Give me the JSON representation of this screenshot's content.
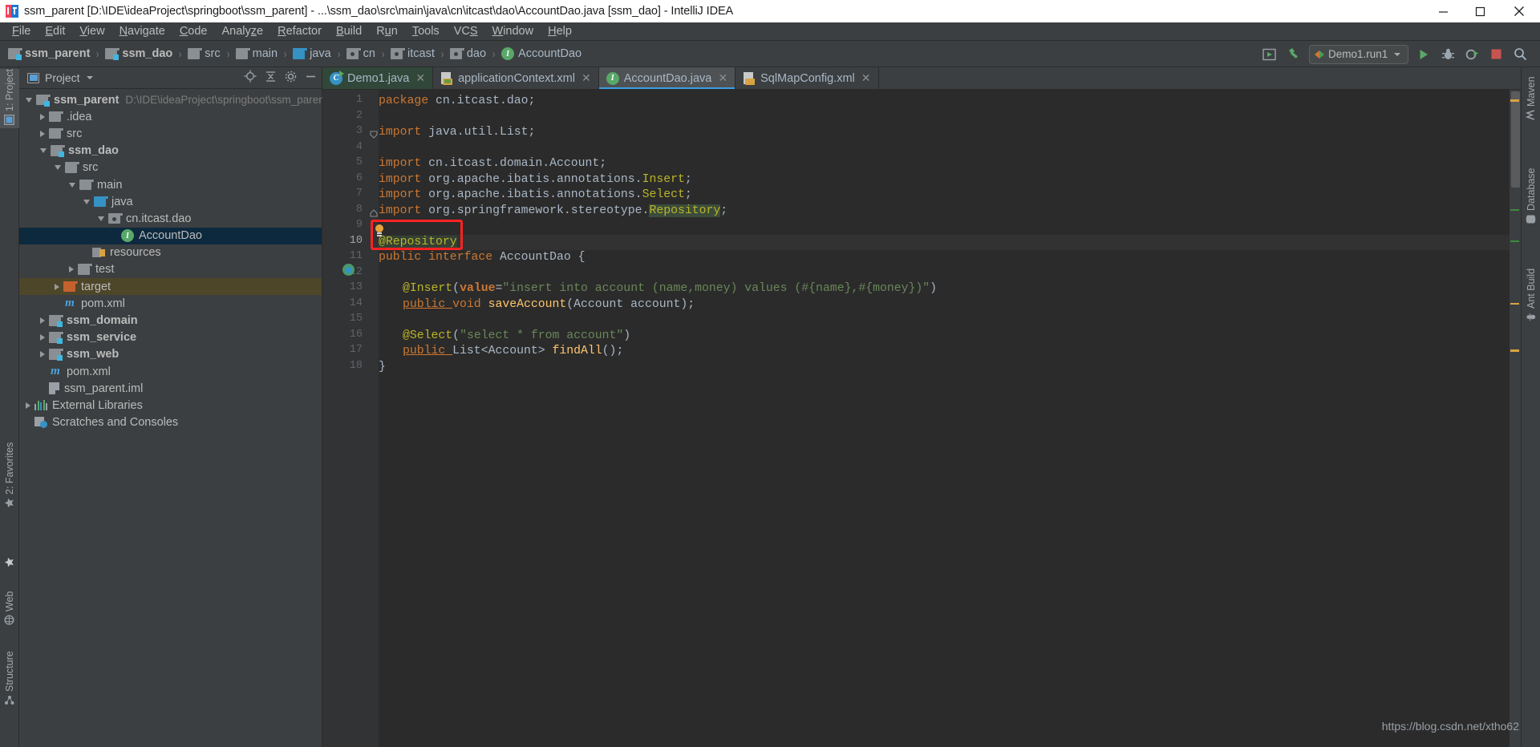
{
  "window": {
    "title": "ssm_parent [D:\\IDE\\ideaProject\\springboot\\ssm_parent] - ...\\ssm_dao\\src\\main\\java\\cn\\itcast\\dao\\AccountDao.java [ssm_dao] - IntelliJ IDEA",
    "icon": "intellij-idea-logo",
    "minimize_label": "Minimize",
    "maximize_label": "Maximize",
    "close_label": "Close"
  },
  "menu": {
    "items": [
      {
        "label": "File",
        "mnemonic": "F"
      },
      {
        "label": "Edit",
        "mnemonic": "E"
      },
      {
        "label": "View",
        "mnemonic": "V"
      },
      {
        "label": "Navigate",
        "mnemonic": "N"
      },
      {
        "label": "Code",
        "mnemonic": "C"
      },
      {
        "label": "Analyze",
        "mnemonic": "z"
      },
      {
        "label": "Refactor",
        "mnemonic": "R"
      },
      {
        "label": "Build",
        "mnemonic": "B"
      },
      {
        "label": "Run",
        "mnemonic": "u"
      },
      {
        "label": "Tools",
        "mnemonic": "T"
      },
      {
        "label": "VCS",
        "mnemonic": "S"
      },
      {
        "label": "Window",
        "mnemonic": "W"
      },
      {
        "label": "Help",
        "mnemonic": "H"
      }
    ]
  },
  "breadcrumb": {
    "separator": "›",
    "items": [
      {
        "label": "ssm_parent",
        "icon": "module-folder-icon",
        "bold": true
      },
      {
        "label": "ssm_dao",
        "icon": "module-folder-icon",
        "bold": true
      },
      {
        "label": "src",
        "icon": "folder-icon",
        "bold": false
      },
      {
        "label": "main",
        "icon": "folder-icon",
        "bold": false
      },
      {
        "label": "java",
        "icon": "source-folder-icon",
        "bold": false
      },
      {
        "label": "cn",
        "icon": "package-icon",
        "bold": false
      },
      {
        "label": "itcast",
        "icon": "package-icon",
        "bold": false
      },
      {
        "label": "dao",
        "icon": "package-icon",
        "bold": false
      },
      {
        "label": "AccountDao",
        "icon": "interface-icon",
        "bold": false
      }
    ]
  },
  "toolbar": {
    "buttons": [
      {
        "name": "select-run-target-icon",
        "label": "Select Run/Debug Target"
      },
      {
        "name": "build-hammer-icon",
        "label": "Build Project"
      }
    ],
    "run_config": {
      "name": "Demo1.run1",
      "icon": "run-configuration-icon",
      "dropdown": "chevron-down-icon"
    },
    "actions": [
      {
        "name": "run-button",
        "label": "Run",
        "color": "#59a869"
      },
      {
        "name": "debug-button",
        "label": "Debug",
        "color": "#9aa7b0"
      },
      {
        "name": "run-coverage-button",
        "label": "Run with Coverage",
        "color": "#9aa7b0"
      },
      {
        "name": "stop-button",
        "label": "Stop",
        "color": "#c75450"
      },
      {
        "name": "search-everywhere-button",
        "label": "Search Everywhere",
        "color": "#a9b7c6"
      }
    ]
  },
  "left_strip": {
    "items": [
      {
        "label": "1: Project",
        "icon": "project-icon",
        "active": true
      },
      {
        "label": "2: Favorites",
        "icon": "favorites-icon",
        "active": false
      },
      {
        "label": "Web",
        "icon": "web-icon",
        "active": false
      },
      {
        "label": "Structure",
        "icon": "structure-icon",
        "active": false
      }
    ]
  },
  "right_strip": {
    "items": [
      {
        "label": "Maven",
        "icon": "maven-icon"
      },
      {
        "label": "Database",
        "icon": "database-icon"
      },
      {
        "label": "Ant Build",
        "icon": "ant-build-icon"
      }
    ]
  },
  "project_panel": {
    "title": "Project",
    "title_dropdown": "chevron-down-icon",
    "actions": [
      {
        "name": "scroll-from-source-icon",
        "label": "Select Opened File"
      },
      {
        "name": "collapse-all-icon",
        "label": "Collapse All"
      },
      {
        "name": "settings-gear-icon",
        "label": "Settings"
      },
      {
        "name": "hide-panel-icon",
        "label": "Hide"
      }
    ],
    "tree": [
      {
        "label": "ssm_parent",
        "secondary": "D:\\IDE\\ideaProject\\springboot\\ssm_parent",
        "indent": 0,
        "arrow": "open",
        "icon": "module-folder-icon",
        "bold": true,
        "state": "normal"
      },
      {
        "label": ".idea",
        "secondary": "",
        "indent": 1,
        "arrow": "closed",
        "icon": "folder-icon",
        "bold": false,
        "state": "normal"
      },
      {
        "label": "src",
        "secondary": "",
        "indent": 1,
        "arrow": "closed",
        "icon": "folder-icon",
        "bold": false,
        "state": "normal"
      },
      {
        "label": "ssm_dao",
        "secondary": "",
        "indent": 1,
        "arrow": "open",
        "icon": "module-folder-icon",
        "bold": true,
        "state": "normal"
      },
      {
        "label": "src",
        "secondary": "",
        "indent": 2,
        "arrow": "open",
        "icon": "folder-icon",
        "bold": false,
        "state": "normal"
      },
      {
        "label": "main",
        "secondary": "",
        "indent": 3,
        "arrow": "open",
        "icon": "folder-icon",
        "bold": false,
        "state": "normal"
      },
      {
        "label": "java",
        "secondary": "",
        "indent": 4,
        "arrow": "open",
        "icon": "source-folder-icon",
        "bold": false,
        "state": "normal"
      },
      {
        "label": "cn.itcast.dao",
        "secondary": "",
        "indent": 5,
        "arrow": "open",
        "icon": "package-icon",
        "bold": false,
        "state": "normal"
      },
      {
        "label": "AccountDao",
        "secondary": "",
        "indent": 6,
        "arrow": "none",
        "icon": "interface-icon",
        "bold": false,
        "state": "selected"
      },
      {
        "label": "resources",
        "secondary": "",
        "indent": 4,
        "arrow": "none",
        "icon": "resources-folder-icon",
        "bold": false,
        "state": "normal"
      },
      {
        "label": "test",
        "secondary": "",
        "indent": 3,
        "arrow": "closed",
        "icon": "folder-icon",
        "bold": false,
        "state": "normal"
      },
      {
        "label": "target",
        "secondary": "",
        "indent": 2,
        "arrow": "closed",
        "icon": "excluded-folder-icon",
        "bold": false,
        "state": "highlighted"
      },
      {
        "label": "pom.xml",
        "secondary": "",
        "indent": 2,
        "arrow": "none",
        "icon": "maven-pom-icon",
        "bold": false,
        "state": "normal"
      },
      {
        "label": "ssm_domain",
        "secondary": "",
        "indent": 1,
        "arrow": "closed",
        "icon": "module-folder-icon",
        "bold": true,
        "state": "normal"
      },
      {
        "label": "ssm_service",
        "secondary": "",
        "indent": 1,
        "arrow": "closed",
        "icon": "module-folder-icon",
        "bold": true,
        "state": "normal"
      },
      {
        "label": "ssm_web",
        "secondary": "",
        "indent": 1,
        "arrow": "closed",
        "icon": "module-folder-icon",
        "bold": true,
        "state": "normal"
      },
      {
        "label": "pom.xml",
        "secondary": "",
        "indent": 1,
        "arrow": "none",
        "icon": "maven-pom-icon",
        "bold": false,
        "state": "normal"
      },
      {
        "label": "ssm_parent.iml",
        "secondary": "",
        "indent": 1,
        "arrow": "none",
        "icon": "iml-file-icon",
        "bold": false,
        "state": "normal"
      },
      {
        "label": "External Libraries",
        "secondary": "",
        "indent": 0,
        "arrow": "closed",
        "icon": "libraries-icon",
        "bold": false,
        "state": "normal"
      },
      {
        "label": "Scratches and Consoles",
        "secondary": "",
        "indent": 0,
        "arrow": "none",
        "icon": "scratches-icon",
        "bold": false,
        "state": "normal"
      }
    ]
  },
  "editor": {
    "tabs": [
      {
        "label": "Demo1.java",
        "icon": "java-class-runnable-icon",
        "state": "runnable",
        "closable": true
      },
      {
        "label": "applicationContext.xml",
        "icon": "spring-xml-icon",
        "state": "normal",
        "closable": true
      },
      {
        "label": "AccountDao.java",
        "icon": "java-interface-icon",
        "state": "active",
        "closable": true
      },
      {
        "label": "SqlMapConfig.xml",
        "icon": "xml-icon",
        "state": "normal",
        "closable": true
      }
    ],
    "current_line": 10,
    "annotation_highlight": {
      "text": "@Repository",
      "color": "#ff2323",
      "line": 10
    },
    "gutter_icons": [
      {
        "name": "intention-bulb-icon",
        "line": 9
      },
      {
        "name": "spring-bean-icon",
        "line": 11
      }
    ],
    "lines": [
      {
        "n": 1,
        "tokens": [
          {
            "t": "package ",
            "c": "k"
          },
          {
            "t": "cn.itcast.dao",
            "c": "pl"
          },
          {
            "t": ";",
            "c": "sem"
          }
        ],
        "indent": 0,
        "fold": ""
      },
      {
        "n": 2,
        "tokens": [],
        "indent": 0,
        "fold": ""
      },
      {
        "n": 3,
        "tokens": [
          {
            "t": "import ",
            "c": "k"
          },
          {
            "t": "java.util.List",
            "c": "pl"
          },
          {
            "t": ";",
            "c": "sem"
          }
        ],
        "indent": 0,
        "fold": "open"
      },
      {
        "n": 4,
        "tokens": [],
        "indent": 0,
        "fold": ""
      },
      {
        "n": 5,
        "tokens": [
          {
            "t": "import ",
            "c": "k"
          },
          {
            "t": "cn.itcast.domain.Account",
            "c": "pl"
          },
          {
            "t": ";",
            "c": "sem"
          }
        ],
        "indent": 0,
        "fold": ""
      },
      {
        "n": 6,
        "tokens": [
          {
            "t": "import ",
            "c": "k"
          },
          {
            "t": "org.apache.ibatis.annotations.",
            "c": "pl"
          },
          {
            "t": "Insert",
            "c": "an"
          },
          {
            "t": ";",
            "c": "sem"
          }
        ],
        "indent": 0,
        "fold": ""
      },
      {
        "n": 7,
        "tokens": [
          {
            "t": "import ",
            "c": "k"
          },
          {
            "t": "org.apache.ibatis.annotations.",
            "c": "pl"
          },
          {
            "t": "Select",
            "c": "an"
          },
          {
            "t": ";",
            "c": "sem"
          }
        ],
        "indent": 0,
        "fold": ""
      },
      {
        "n": 8,
        "tokens": [
          {
            "t": "import ",
            "c": "k"
          },
          {
            "t": "org.springframework.stereotype.",
            "c": "pl"
          },
          {
            "t": "Repository",
            "c": "hl2"
          },
          {
            "t": ";",
            "c": "sem"
          }
        ],
        "indent": 0,
        "fold": "close"
      },
      {
        "n": 9,
        "tokens": [],
        "indent": 0,
        "fold": ""
      },
      {
        "n": 10,
        "tokens": [
          {
            "t": "@Repository",
            "c": "hl"
          }
        ],
        "indent": 0,
        "fold": ""
      },
      {
        "n": 11,
        "tokens": [
          {
            "t": "public ",
            "c": "k"
          },
          {
            "t": "interface ",
            "c": "k"
          },
          {
            "t": "AccountDao",
            "c": "pl"
          },
          {
            "t": " {",
            "c": "pl"
          }
        ],
        "indent": 0,
        "fold": ""
      },
      {
        "n": 12,
        "tokens": [],
        "indent": 0,
        "fold": ""
      },
      {
        "n": 13,
        "tokens": [
          {
            "t": "@Insert",
            "c": "an"
          },
          {
            "t": "(",
            "c": "pl"
          },
          {
            "t": "value",
            "c": "kb"
          },
          {
            "t": "=",
            "c": "pl"
          },
          {
            "t": "\"insert into account (name,money) values (#{name},#{money})\"",
            "c": "st"
          },
          {
            "t": ")",
            "c": "pl"
          }
        ],
        "indent": 1,
        "fold": ""
      },
      {
        "n": 14,
        "tokens": [
          {
            "t": "public ",
            "c": "ul-kw"
          },
          {
            "t": "void ",
            "c": "k"
          },
          {
            "t": "saveAccount",
            "c": "mname"
          },
          {
            "t": "(Account account)",
            "c": "pl"
          },
          {
            "t": ";",
            "c": "sem"
          }
        ],
        "indent": 1,
        "fold": ""
      },
      {
        "n": 15,
        "tokens": [],
        "indent": 0,
        "fold": ""
      },
      {
        "n": 16,
        "tokens": [
          {
            "t": "@Select",
            "c": "an"
          },
          {
            "t": "(",
            "c": "pl"
          },
          {
            "t": "\"select * from account\"",
            "c": "st"
          },
          {
            "t": ")",
            "c": "pl"
          }
        ],
        "indent": 1,
        "fold": ""
      },
      {
        "n": 17,
        "tokens": [
          {
            "t": "public ",
            "c": "ul-kw"
          },
          {
            "t": "List<Account> ",
            "c": "pl"
          },
          {
            "t": "findAll",
            "c": "mname"
          },
          {
            "t": "()",
            "c": "pl"
          },
          {
            "t": ";",
            "c": "sem"
          }
        ],
        "indent": 1,
        "fold": ""
      },
      {
        "n": 18,
        "tokens": [
          {
            "t": "}",
            "c": "pl"
          }
        ],
        "indent": 0,
        "fold": ""
      }
    ],
    "markers": [
      {
        "line": 1,
        "color": "#d9a343"
      },
      {
        "line": 8,
        "color": "#3d8a3d"
      },
      {
        "line": 10,
        "color": "#3d8a3d"
      },
      {
        "line": 14,
        "color": "#d9a343"
      },
      {
        "line": 17,
        "color": "#d9a343"
      }
    ]
  },
  "watermark": "https://blog.csdn.net/xtho62"
}
